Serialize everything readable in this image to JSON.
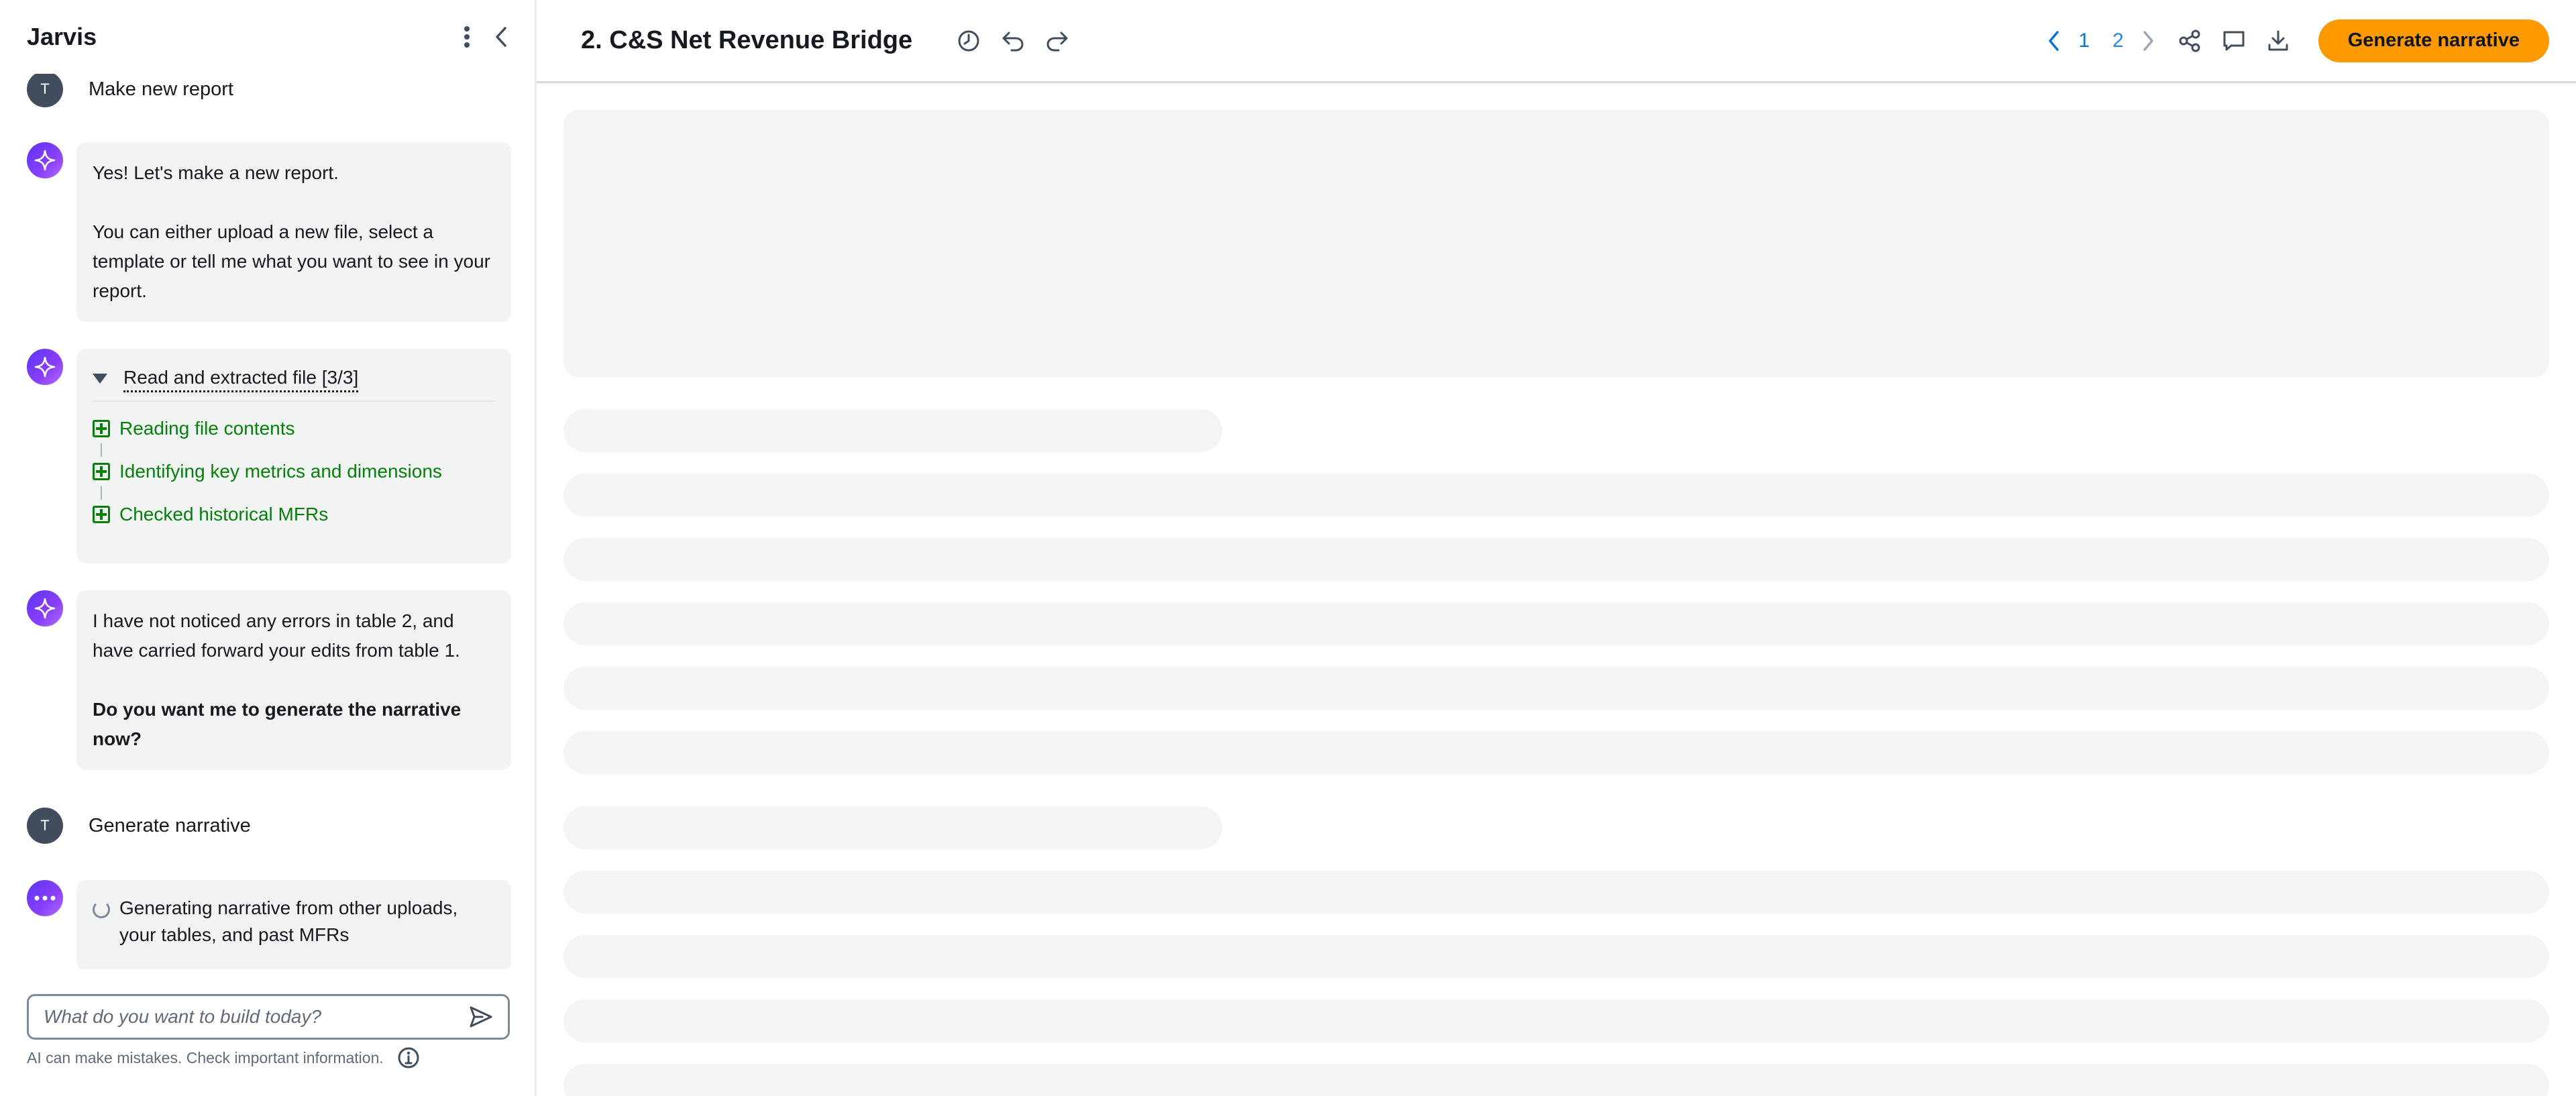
{
  "sidebar": {
    "app_name": "Jarvis",
    "messages": {
      "user1": {
        "avatar": "T",
        "text": "Make new report"
      },
      "ai1": {
        "line1": "Yes! Let's make a new report.",
        "line2": "You can either upload a new file, select a template or tell me what you want to see in your report."
      },
      "ai2": {
        "task_title": "Read and extracted file [3/3]",
        "steps": [
          "Reading file contents",
          "Identifying key metrics and dimensions",
          "Checked historical MFRs"
        ]
      },
      "ai3": {
        "line1": "I have not noticed any errors in table 2, and have carried forward your edits from table 1.",
        "line2": "Do you want me to generate the narrative now?"
      },
      "user2": {
        "avatar": "T",
        "text": "Generate narrative"
      },
      "ai4": {
        "status": "Generating narrative from other uploads, your tables, and past MFRs"
      }
    },
    "composer": {
      "placeholder": "What do you want to build today?"
    },
    "disclaimer": "AI can make mistakes. Check important information."
  },
  "toolbar": {
    "title": "2. C&S Net Revenue Bridge",
    "pages": [
      "1",
      "2"
    ],
    "current_page": "1",
    "generate_label": "Generate narrative"
  },
  "icons": {
    "more": "more-vertical-icon",
    "collapse": "chevron-left-icon",
    "ai_avatar": "sparkle-icon",
    "history": "history-icon",
    "undo": "undo-icon",
    "redo": "redo-icon",
    "share": "share-icon",
    "comment": "comment-icon",
    "download": "download-icon",
    "send": "send-icon",
    "info": "info-icon"
  },
  "colors": {
    "accent": "#ff9900",
    "success": "#037f0c",
    "link": "#0972d3",
    "ai_gradient_start": "#5b34f5",
    "ai_gradient_end": "#b26cff"
  }
}
